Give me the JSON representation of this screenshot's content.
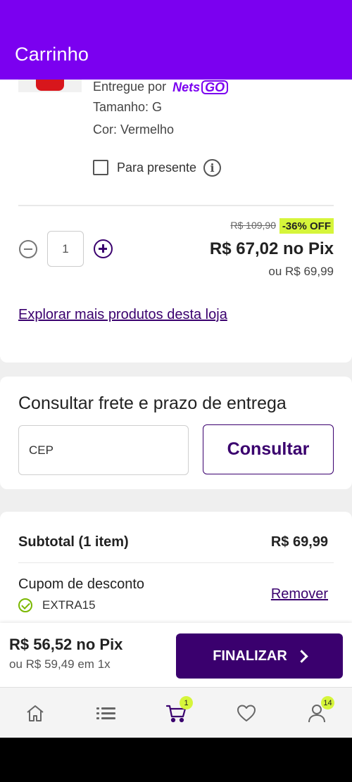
{
  "header": {
    "title": "Carrinho"
  },
  "item": {
    "delivered_by_label": "Entregue por",
    "seller_logo": {
      "part1": "Nets",
      "part2": "GO"
    },
    "size": "Tamanho: G",
    "color": "Cor: Vermelho",
    "gift_label": "Para presente",
    "quantity": "1",
    "old_price": "R$ 109,90",
    "discount": "-36% OFF",
    "pix_price": "R$ 67,02 no Pix",
    "card_price": "ou R$ 69,99",
    "explore_link": "Explorar mais produtos desta loja"
  },
  "shipping": {
    "title": "Consultar frete e prazo de entrega",
    "cep_placeholder": "CEP",
    "consult_button": "Consultar"
  },
  "summary": {
    "subtotal_label": "Subtotal (1 item)",
    "subtotal_value": "R$ 69,99",
    "coupon_label": "Cupom de desconto",
    "coupon_code": "EXTRA15",
    "remove_link": "Remover"
  },
  "checkout": {
    "total_pix": "R$ 56,52 no Pix",
    "total_card": "ou R$ 59,49 em 1x",
    "finalize_button": "FINALIZAR"
  },
  "bottom_nav": {
    "items": [
      {
        "icon": "home-icon"
      },
      {
        "icon": "menu-list-icon"
      },
      {
        "icon": "cart-icon",
        "badge": "1"
      },
      {
        "icon": "heart-icon"
      },
      {
        "icon": "user-icon",
        "badge": "14"
      }
    ]
  },
  "colors": {
    "header": "#7b00f0",
    "primary_dark": "#3a006e",
    "accent_badge": "#d6f53a",
    "success": "#7ab800"
  }
}
